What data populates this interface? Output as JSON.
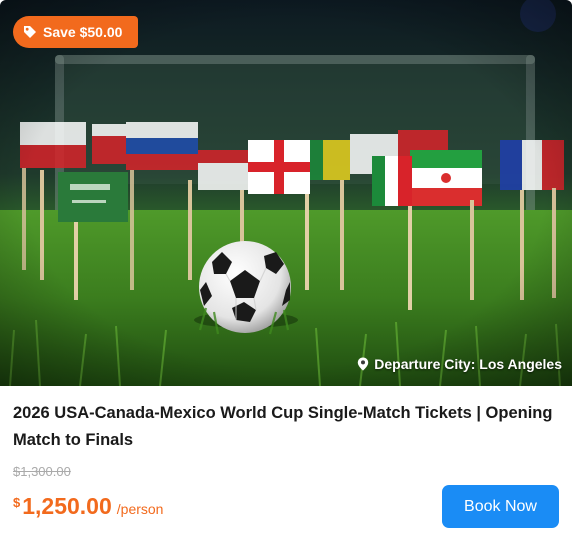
{
  "badge": {
    "label": "Save $50.00",
    "icon": "tag-icon",
    "color": "#f26a1d"
  },
  "hero": {
    "departure_label": "Departure City: Los Angeles",
    "icon": "location-pin-icon"
  },
  "product": {
    "title": "2026 USA-Canada-Mexico World Cup Single-Match Tickets | Opening Match to Finals"
  },
  "pricing": {
    "original_price": "$1,300.00",
    "currency_symbol": "$",
    "price": "1,250.00",
    "unit": "/person",
    "accent_color": "#f26a1d"
  },
  "actions": {
    "book_label": "Book Now",
    "button_color": "#1a8cf5"
  }
}
